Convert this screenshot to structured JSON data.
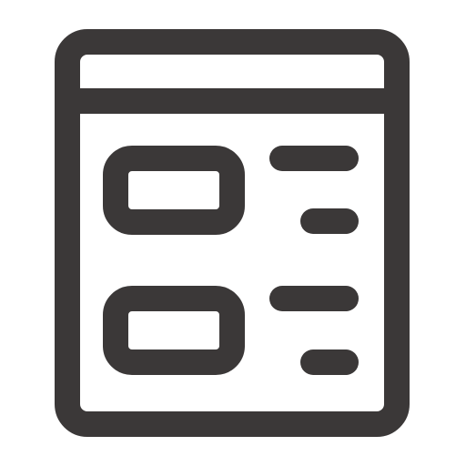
{
  "icon": {
    "name": "list-layout-icon",
    "stroke_color": "#3b3838",
    "background_color": "#ffffff",
    "rows": [
      {
        "name": "row-1"
      },
      {
        "name": "row-2"
      }
    ]
  }
}
